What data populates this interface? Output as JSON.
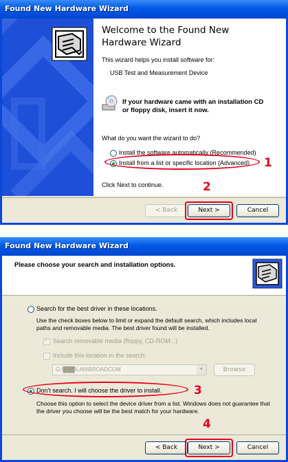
{
  "window1": {
    "title": "Found New Hardware Wizard",
    "heading_line1": "Welcome to the Found New",
    "heading_line2": "Hardware Wizard",
    "intro": "This wizard helps you install software for:",
    "device": "USB Test and Measurement Device",
    "cd_line1": "If your hardware came with an installation CD",
    "cd_line2": "or floppy disk, insert it now.",
    "question": "What do you want the wizard to do?",
    "option_auto": "Install the software automatically (Recommended)",
    "option_list": "Install from a list or specific location (Advanced)",
    "continue_text": "Click Next to continue.",
    "back_label": "< Back",
    "next_label": "Next >",
    "cancel_label": "Cancel",
    "step_a": "1",
    "step_b": "2"
  },
  "window2": {
    "title": "Found New Hardware Wizard",
    "header": "Please choose your search and installation options.",
    "option_search": "Search for the best driver in these locations.",
    "search_desc_line1": "Use the check boxes below to limit or expand the default search, which includes local",
    "search_desc_line2": "paths and removable media. The best driver found will be installed.",
    "check_removable": "Search removable media (floppy, CD-ROM...)",
    "check_include": "Include this location in the search:",
    "path_value": "G:\\███\\LAN\\BROADCOM",
    "browse_label": "Browse",
    "option_dont_search": "Don't search. I will choose the driver to install.",
    "dont_desc_line1": "Choose this option to select the device driver from a list.  Windows does not guarantee that",
    "dont_desc_line2": "the driver you choose will be the best match for your hardware.",
    "back_label": "< Back",
    "next_label": "Next >",
    "cancel_label": "Cancel",
    "step_a": "3",
    "step_b": "4"
  },
  "colors": {
    "accent_red": "#e8001c",
    "xp_blue": "#0058e6",
    "dialog_face": "#ece9d8"
  }
}
